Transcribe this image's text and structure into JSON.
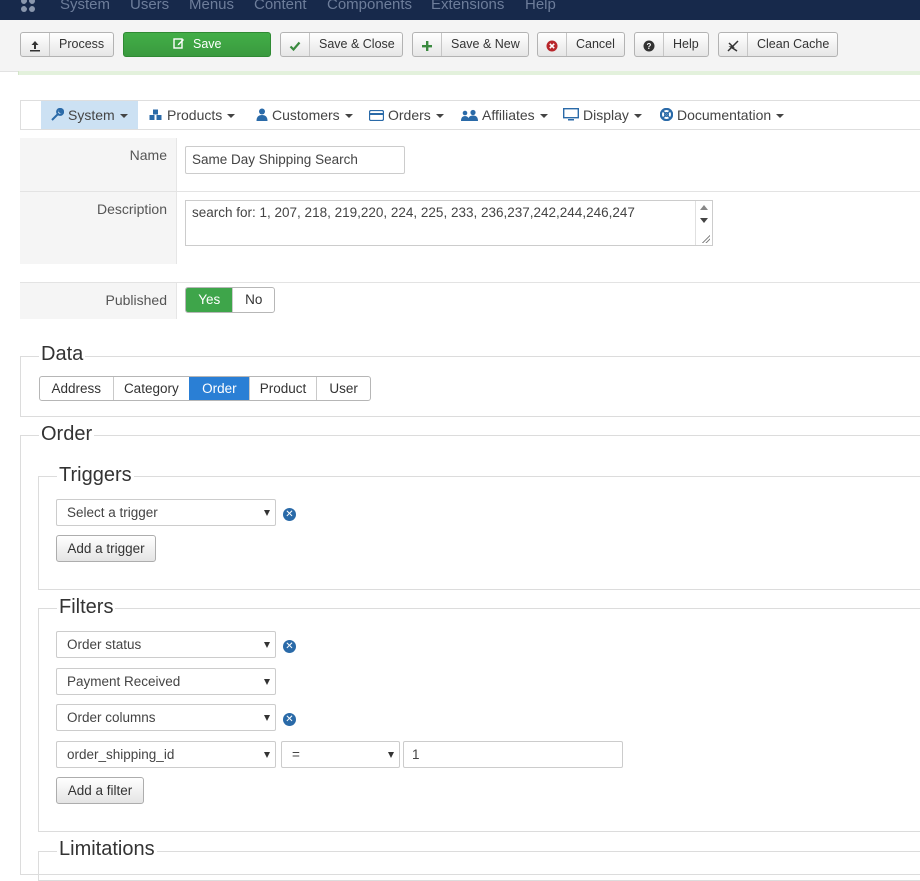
{
  "topnav": {
    "logo_icon": "joomla-logo-icon",
    "items": [
      "System",
      "Users",
      "Menus",
      "Content",
      "Components",
      "Extensions",
      "Help"
    ]
  },
  "toolbar": {
    "process": {
      "label": "Process",
      "icon": "upload-icon"
    },
    "save": {
      "label": "Save",
      "icon": "edit-icon"
    },
    "save_close": {
      "label": "Save & Close",
      "icon": "checkmark-icon"
    },
    "save_new": {
      "label": "Save & New",
      "icon": "plus-icon"
    },
    "cancel": {
      "label": "Cancel",
      "icon": "cancel-circle-icon"
    },
    "help": {
      "label": "Help",
      "icon": "question-circle-icon"
    },
    "clean_cache": {
      "label": "Clean Cache",
      "icon": "lightning-icon"
    }
  },
  "component_nav": {
    "items": [
      {
        "label": "System",
        "icon": "wrench-icon",
        "active": true
      },
      {
        "label": "Products",
        "icon": "cubes-icon"
      },
      {
        "label": "Customers",
        "icon": "user-icon"
      },
      {
        "label": "Orders",
        "icon": "credit-card-icon"
      },
      {
        "label": "Affiliates",
        "icon": "users-icon"
      },
      {
        "label": "Display",
        "icon": "monitor-icon"
      },
      {
        "label": "Documentation",
        "icon": "lifebuoy-icon"
      }
    ]
  },
  "form": {
    "name": {
      "label": "Name",
      "value": "Same Day Shipping Search"
    },
    "description": {
      "label": "Description",
      "value": "search for: 1, 207, 218, 219,220, 224, 225, 233, 236,237,242,244,246,247"
    },
    "published": {
      "label": "Published",
      "yes": "Yes",
      "no": "No",
      "selected": "Yes"
    }
  },
  "data_section": {
    "legend": "Data",
    "tabs": [
      "Address",
      "Category",
      "Order",
      "Product",
      "User"
    ],
    "selected": "Order"
  },
  "order_section": {
    "legend": "Order",
    "triggers": {
      "legend": "Triggers",
      "select_placeholder": "Select a trigger",
      "add_button": "Add a trigger"
    },
    "filters": {
      "legend": "Filters",
      "filter1_type": "Order status",
      "filter1_value": "Payment Received",
      "filter2_type": "Order columns",
      "filter2_column": "order_shipping_id",
      "filter2_operator": "=",
      "filter2_value": "1",
      "add_button": "Add a filter"
    },
    "limitations": {
      "legend": "Limitations"
    }
  },
  "colors": {
    "topnav_bg": "#17294b",
    "save_green": "#3ea54a",
    "selected_tab_blue": "#2a7fd5",
    "active_nav_bg": "#cce1f3",
    "remove_icon_blue": "#2a6aa8"
  }
}
